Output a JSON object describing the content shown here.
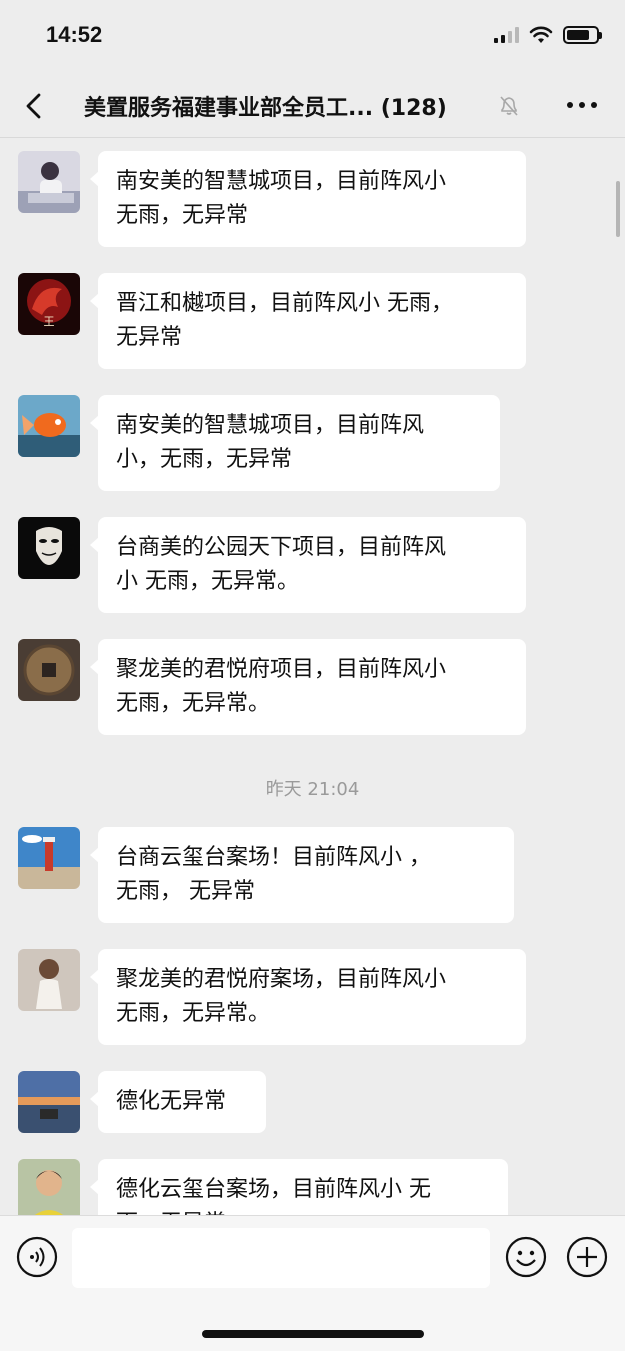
{
  "status_bar": {
    "time": "14:52"
  },
  "header": {
    "title": "美置服务福建事业部全员工...",
    "member_count": "(128)"
  },
  "messages": [
    {
      "lines": [
        "南安美的智慧城项目，目前阵风小",
        " 无雨，无异常"
      ],
      "avatar": "avatar-man-laptop"
    },
    {
      "lines": [
        "晋江和樾项目，目前阵风小 无雨，",
        "无异常"
      ],
      "avatar": "avatar-red-dragon"
    },
    {
      "lines": [
        "南安美的智慧城项目，目前阵风",
        "小，无雨，无异常"
      ],
      "avatar": "avatar-goldfish"
    },
    {
      "lines": [
        "台商美的公园天下项目，目前阵风",
        "小 无雨，无异常。"
      ],
      "avatar": "avatar-mask"
    },
    {
      "lines": [
        "聚龙美的君悦府项目，目前阵风小",
        " 无雨，无异常。"
      ],
      "avatar": "avatar-coin"
    },
    {
      "lines": [
        "台商云玺台案场！目前阵风小 ，",
        "无雨， 无异常"
      ],
      "avatar": "avatar-lighthouse"
    },
    {
      "lines": [
        "聚龙美的君悦府案场，目前阵风小",
        " 无雨，无异常。"
      ],
      "avatar": "avatar-girl"
    },
    {
      "lines": [
        "德化无异常"
      ],
      "avatar": "avatar-sunset"
    },
    {
      "lines": [
        "德化云玺台案场，目前阵风小 无",
        "雨，无异常"
      ],
      "avatar": "avatar-young-man"
    }
  ],
  "timestamp": "昨天 21:04",
  "colors": {
    "background": "#ededed",
    "bubble": "#ffffff",
    "text": "#111111",
    "timestamp": "#9a9a9a"
  },
  "icons": [
    "back-icon",
    "mute-icon",
    "more-icon",
    "voice-icon",
    "emoji-icon",
    "plus-icon"
  ]
}
